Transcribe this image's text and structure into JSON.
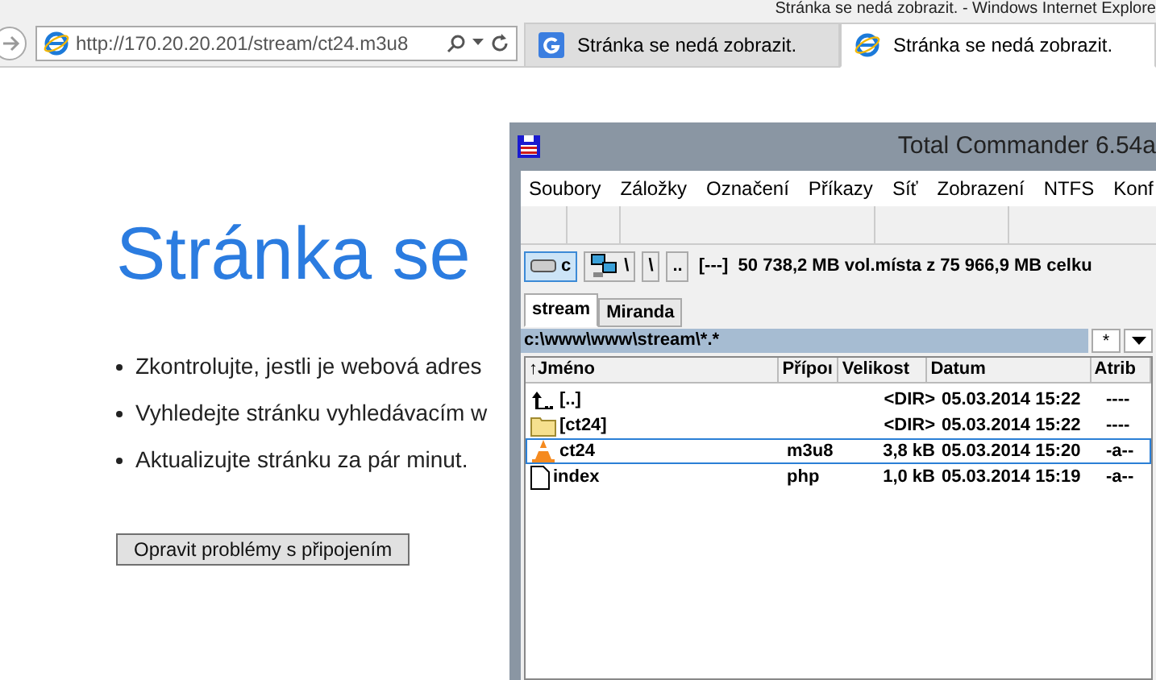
{
  "window": {
    "title": "Stránka se nedá zobrazit. - Windows Internet Explore"
  },
  "address_bar": {
    "url": "http://170.20.20.201/stream/ct24.m3u8"
  },
  "tabs": [
    {
      "label": "Stránka se nedá zobrazit.",
      "kind": "google",
      "selected": false
    },
    {
      "label": "Stránka se nedá zobrazit.",
      "kind": "ie",
      "selected": true
    }
  ],
  "page": {
    "heading": "Stránka se",
    "bullets": [
      "Zkontrolujte, jestli je webová adres",
      "Vyhledejte stránku vyhledávacím w",
      "Aktualizujte stránku za pár minut."
    ],
    "button": "Opravit problémy s připojením"
  },
  "commander": {
    "title": "Total Commander 6.54a",
    "menu": [
      "Soubory",
      "Záložky",
      "Označení",
      "Příkazy",
      "Síť",
      "Zobrazení",
      "NTFS",
      "Konf"
    ],
    "drive_buttons": [
      {
        "label": "c",
        "kind": "drive",
        "selected": true
      },
      {
        "label": "\\",
        "kind": "network",
        "selected": false
      },
      {
        "label": "\\",
        "kind": "plain",
        "selected": false
      },
      {
        "label": "..",
        "kind": "plain",
        "selected": false
      }
    ],
    "free_space": "[---]  50 738,2 MB vol.místa z 75 966,9 MB celku",
    "tabs": [
      {
        "label": "stream",
        "selected": true
      },
      {
        "label": "Miranda",
        "selected": false
      }
    ],
    "path": "c:\\www\\www\\stream\\*.*",
    "path_buttons": [
      "*"
    ],
    "columns": [
      "↑Jméno",
      "Přípoı",
      "Velikost",
      "Datum",
      "Atrib"
    ],
    "files": [
      {
        "kind": "up",
        "name": "[..]",
        "size": "<DIR>",
        "date": "05.03.2014 15:22",
        "attr": "----",
        "selected": false
      },
      {
        "kind": "folder",
        "name": "[ct24]",
        "size": "<DIR>",
        "date": "05.03.2014 15:22",
        "attr": "----",
        "selected": false
      },
      {
        "kind": "cone",
        "name": "ct24",
        "ext": "m3u8",
        "size": "3,8 kB",
        "date": "05.03.2014 15:20",
        "attr": "-a--",
        "selected": true
      },
      {
        "kind": "file",
        "name": "index",
        "ext": "php",
        "size": "1,0 kB",
        "date": "05.03.2014 15:19",
        "attr": "-a--",
        "selected": false
      }
    ]
  }
}
